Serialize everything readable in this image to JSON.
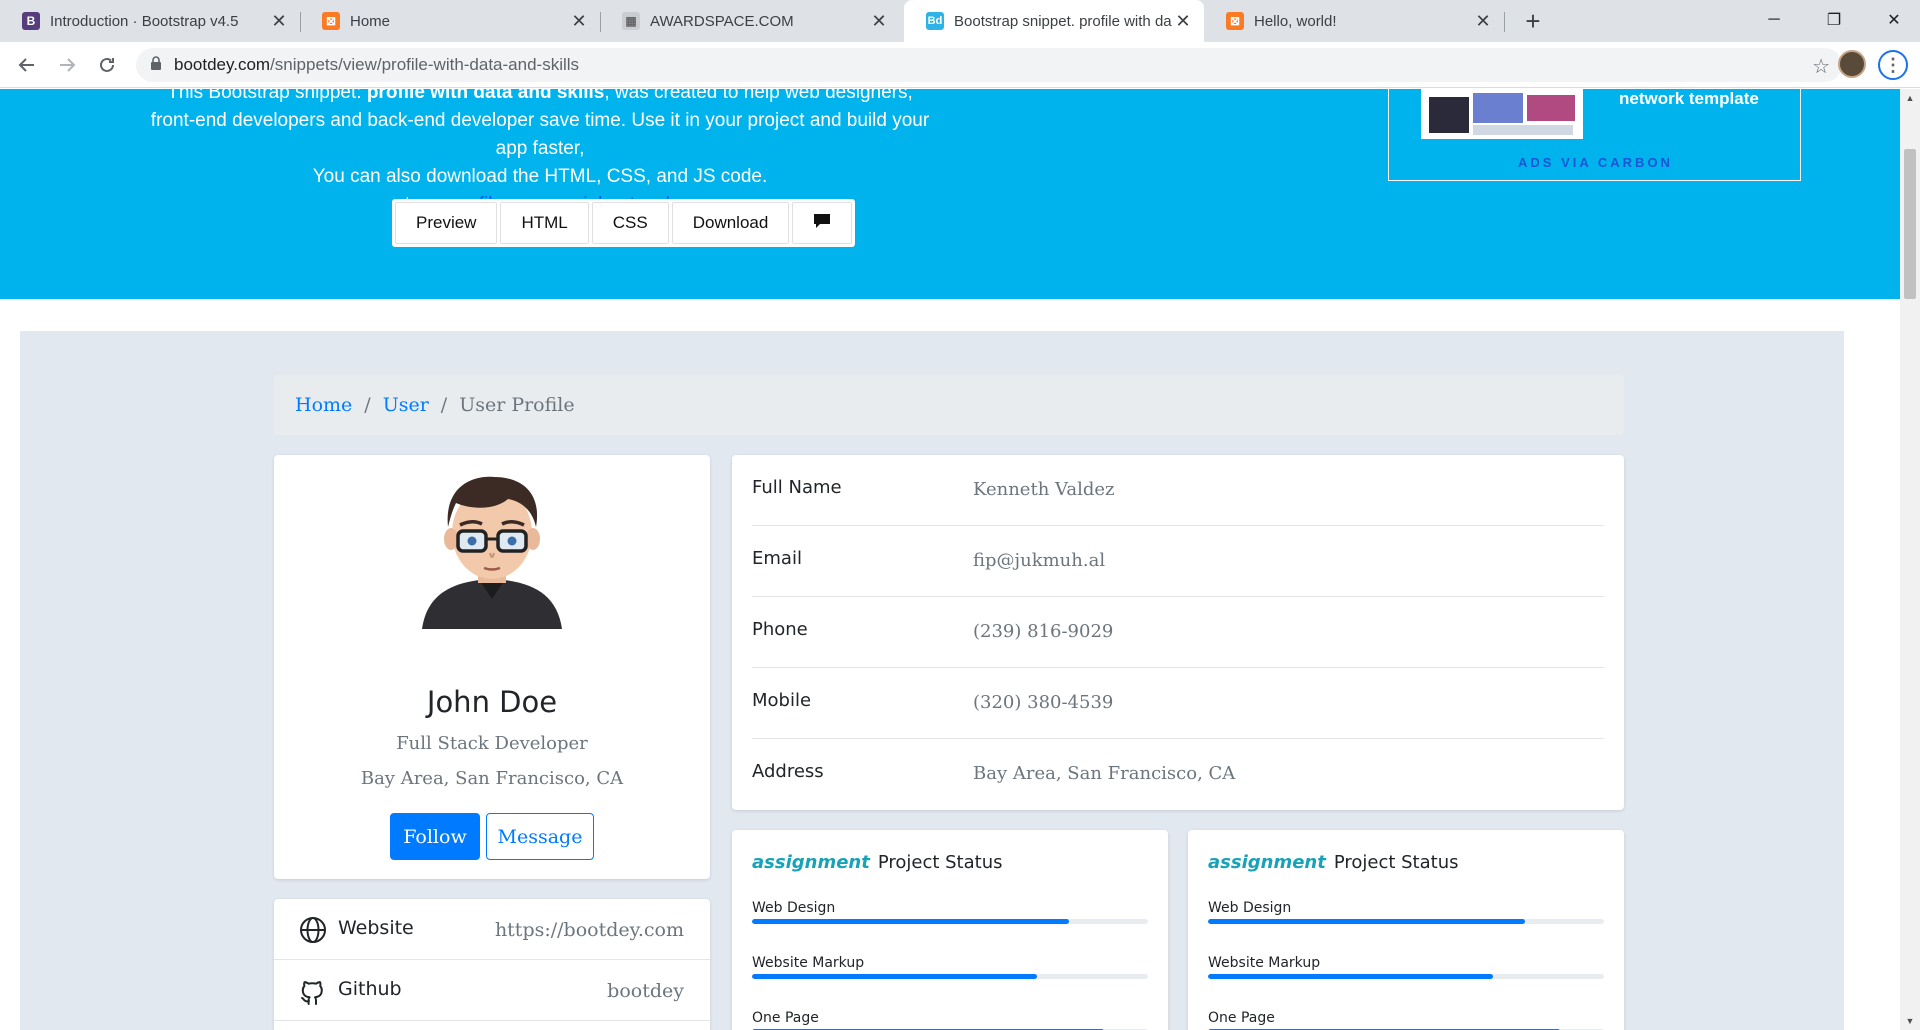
{
  "browser": {
    "tabs": [
      {
        "title": "Introduction · Bootstrap v4.5",
        "fav_letter": "B",
        "fav_color": "#563d7c"
      },
      {
        "title": "Home",
        "fav_letter": "⊠",
        "fav_color": "#fb7a24"
      },
      {
        "title": "AWARDSPACE.COM",
        "fav_letter": "▦",
        "fav_color": "#c9ccd1"
      },
      {
        "title": "Bootstrap snippet. profile with da",
        "fav_letter": "Bd",
        "fav_color": "#2eb3e8"
      },
      {
        "title": "Hello, world!",
        "fav_letter": "⊠",
        "fav_color": "#fb7a24"
      }
    ],
    "active_tab": 3,
    "url_host": "bootdey.com",
    "url_path": "/snippets/view/profile-with-data-and-skills"
  },
  "hero": {
    "line1_pre": "This Bootstrap snippet: ",
    "line1_bold": "profile with data and skills",
    "line1_post": ", was created to help web designers,",
    "line2": "front-end developers and back-end developer save time. Use it in your project and build your app faster,",
    "line3": "You can also download the HTML, CSS, and JS code.",
    "tags_label": "tags:",
    "tags": [
      " profile ",
      " cv ",
      " social-network"
    ],
    "buttons": [
      "Preview",
      "HTML",
      "CSS",
      "Download"
    ],
    "ad_text": "network template",
    "ad_via": "ADS VIA CARBON"
  },
  "breadcrumb": {
    "home": "Home",
    "user": "User",
    "current": "User Profile"
  },
  "profile": {
    "name": "John Doe",
    "role": "Full Stack Developer",
    "location": "Bay Area, San Francisco, CA",
    "follow": "Follow",
    "message": "Message"
  },
  "links": [
    {
      "label": "Website",
      "value": "https://bootdey.com",
      "icon": "globe-icon"
    },
    {
      "label": "Github",
      "value": "bootdey",
      "icon": "github-icon"
    }
  ],
  "info": [
    {
      "key": "Full Name",
      "value": "Kenneth Valdez"
    },
    {
      "key": "Email",
      "value": "fip@jukmuh.al"
    },
    {
      "key": "Phone",
      "value": "(239) 816-9029"
    },
    {
      "key": "Mobile",
      "value": "(320) 380-4539"
    },
    {
      "key": "Address",
      "value": "Bay Area, San Francisco, CA"
    }
  ],
  "status_cards": [
    {
      "icon_word": "assignment",
      "title": "Project Status",
      "bars": [
        {
          "label": "Web Design",
          "percent": 80
        },
        {
          "label": "Website Markup",
          "percent": 72
        },
        {
          "label": "One Page",
          "percent": 89
        }
      ]
    },
    {
      "icon_word": "assignment",
      "title": "Project Status",
      "bars": [
        {
          "label": "Web Design",
          "percent": 80
        },
        {
          "label": "Website Markup",
          "percent": 72
        },
        {
          "label": "One Page",
          "percent": 89
        }
      ]
    }
  ],
  "colors": {
    "hero": "#00b3ec",
    "primary": "#007bff",
    "accent": "#17a2b8",
    "page_bg": "#e2e8f0"
  }
}
